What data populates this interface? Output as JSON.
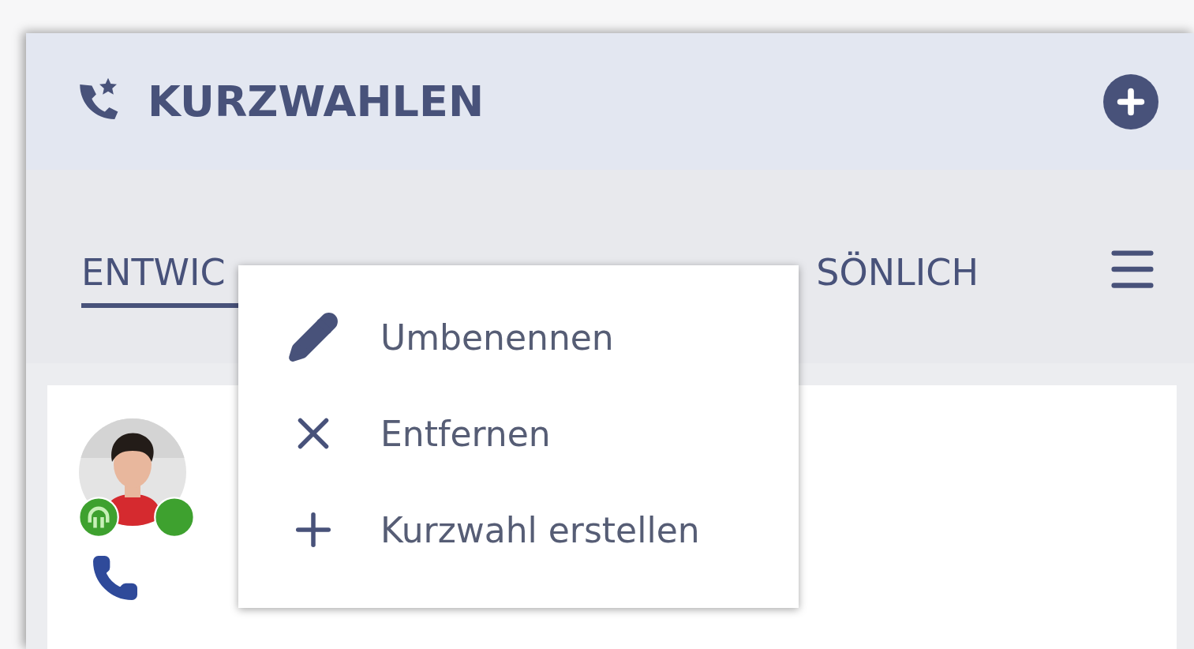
{
  "header": {
    "title": "KURZWAHLEN"
  },
  "tabs": [
    {
      "label": "ENTWIC",
      "selected": true
    },
    {
      "label": "SÖNLICH",
      "selected": false
    }
  ],
  "context_menu": {
    "items": [
      {
        "kind": "rename",
        "label": "Umbenennen"
      },
      {
        "kind": "remove",
        "label": "Entfernen"
      },
      {
        "kind": "create",
        "label": "Kurzwahl erstellen"
      }
    ]
  }
}
